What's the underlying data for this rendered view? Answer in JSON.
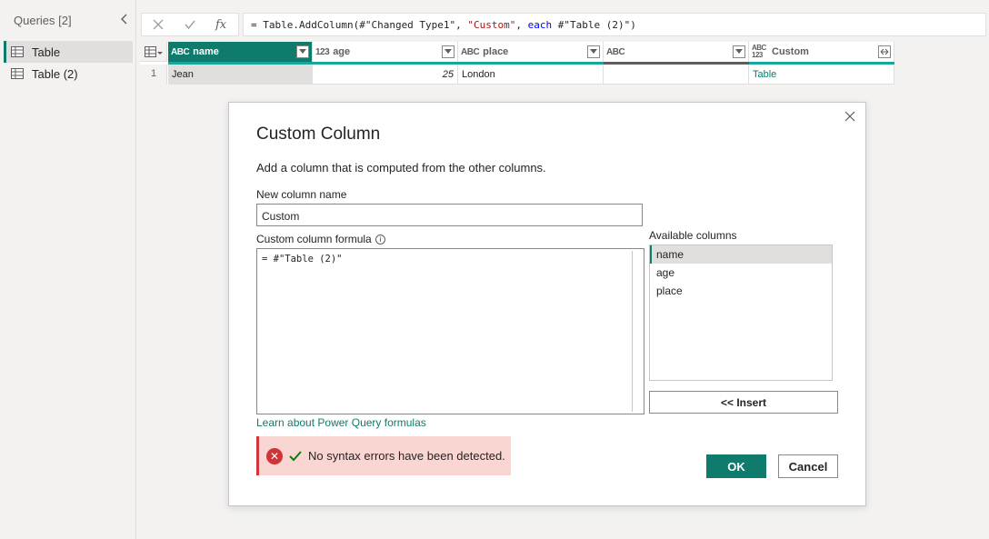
{
  "queries": {
    "header": "Queries [2]",
    "items": [
      {
        "label": "Table",
        "selected": true
      },
      {
        "label": "Table (2)",
        "selected": false
      }
    ]
  },
  "formula_bar": {
    "prefix": "= Table.AddColumn(#\"Changed Type1\", ",
    "string_part": "\"Custom\"",
    "sep": ", ",
    "each_kw": "each",
    "suffix": " #\"Table (2)\")"
  },
  "grid": {
    "columns": [
      {
        "type": "ABC",
        "name": "name"
      },
      {
        "type": "123",
        "name": "age"
      },
      {
        "type": "ABC",
        "name": "place"
      },
      {
        "type": "ABC",
        "name": ""
      },
      {
        "type": "ABC 123",
        "name": "Custom"
      }
    ],
    "rows": [
      {
        "num": "1",
        "cells": [
          "Jean",
          "25",
          "London",
          "",
          "Table"
        ]
      }
    ]
  },
  "dialog": {
    "title": "Custom Column",
    "description": "Add a column that is computed from the other columns.",
    "new_column_label": "New column name",
    "new_column_value": "Custom",
    "formula_label": "Custom column formula",
    "formula_value": "= #\"Table (2)\"",
    "available_label": "Available columns",
    "available_columns": [
      "name",
      "age",
      "place"
    ],
    "insert_label": "<< Insert",
    "learn_link": "Learn about Power Query formulas",
    "status_text": "No syntax errors have been detected.",
    "ok_label": "OK",
    "cancel_label": "Cancel"
  },
  "colors": {
    "accent": "#0f7b6c",
    "error": "#d13438",
    "success": "#107c10"
  }
}
